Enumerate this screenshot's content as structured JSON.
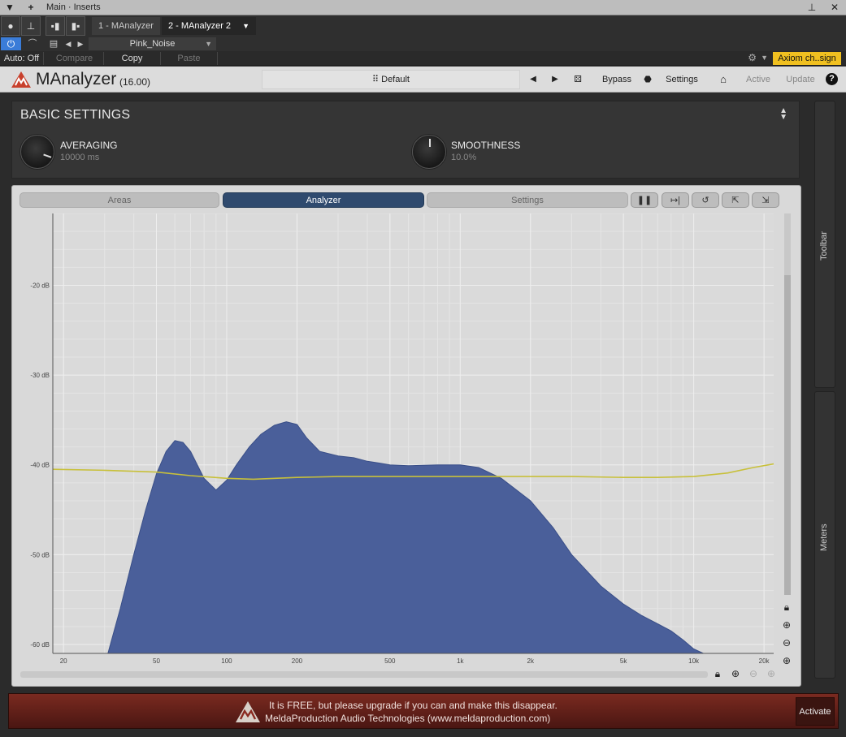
{
  "host": {
    "title": "Main · Inserts",
    "tabs": [
      {
        "label": "1 - MAnalyzer"
      },
      {
        "label": "2 - MAnalyzer 2"
      }
    ],
    "preset_name": "Pink_Noise",
    "auto_label": "Auto: Off",
    "compare_label": "Compare",
    "copy_label": "Copy",
    "paste_label": "Paste",
    "user_badge": "Axiom ch..sign"
  },
  "plugin": {
    "name": "MAnalyzer",
    "version": "(16.00)",
    "preset": "Default",
    "bypass_label": "Bypass",
    "settings_label": "Settings",
    "active_label": "Active",
    "update_label": "Update",
    "help_label": "?"
  },
  "basic_settings": {
    "title": "BASIC SETTINGS",
    "averaging": {
      "label": "AVERAGING",
      "value": "10000 ms",
      "level": 0.9
    },
    "smoothness": {
      "label": "SMOOTHNESS",
      "value": "10.0%",
      "level": 0.1
    }
  },
  "analyzer": {
    "tabs": [
      {
        "label": "Areas"
      },
      {
        "label": "Analyzer"
      },
      {
        "label": "Settings"
      }
    ],
    "active_tab": 1
  },
  "side": {
    "toolbar_label": "Toolbar",
    "meters_label": "Meters"
  },
  "footer": {
    "line1": "It is FREE, but please upgrade if you can and make this disappear.",
    "line2": "MeldaProduction Audio Technologies (www.meldaproduction.com)",
    "activate_label": "Activate"
  },
  "chart_data": {
    "type": "area",
    "x_scale": "log",
    "xlim": [
      18,
      22000
    ],
    "ylim": [
      -61,
      -12
    ],
    "x_ticks": [
      20,
      50,
      100,
      200,
      500,
      1000,
      2000,
      5000,
      10000,
      20000
    ],
    "x_tick_labels": [
      "20",
      "50",
      "100",
      "200",
      "500",
      "1k",
      "2k",
      "5k",
      "10k",
      "20k"
    ],
    "y_ticks": [
      -20,
      -30,
      -40,
      -50,
      -60
    ],
    "y_tick_labels": [
      "-20 dB",
      "-30 dB",
      "-40 dB",
      "-50 dB",
      "-60 dB"
    ],
    "grid": true,
    "colors": {
      "spectrum": "#4a5f9a",
      "average": "#c8c03a"
    },
    "series": [
      {
        "x": [
          31,
          35,
          40,
          45,
          50,
          55,
          60,
          65,
          70,
          80,
          90,
          100,
          110,
          125,
          140,
          160,
          180,
          200,
          220,
          250,
          300,
          350,
          400,
          450,
          500,
          600,
          800,
          1000,
          1200,
          1500,
          2000,
          2500,
          3000,
          4000,
          5000,
          6000,
          7000,
          8000,
          9000,
          10000,
          11000
        ],
        "y": [
          -61,
          -56,
          -50,
          -45,
          -41,
          -38.5,
          -37.3,
          -37.5,
          -38.5,
          -41.5,
          -42.8,
          -41.7,
          -40,
          -38,
          -36.6,
          -35.6,
          -35.2,
          -35.5,
          -37,
          -38.5,
          -39,
          -39.2,
          -39.6,
          -39.8,
          -40,
          -40.1,
          -40,
          -40,
          -40.3,
          -41.5,
          -44,
          -47,
          -50,
          -53.5,
          -55.5,
          -56.8,
          -57.7,
          -58.5,
          -59.5,
          -60.5,
          -61
        ]
      },
      {
        "x": [
          18,
          30,
          50,
          70,
          100,
          130,
          200,
          300,
          500,
          1000,
          2000,
          3000,
          5000,
          7000,
          10000,
          14000,
          18000,
          22000
        ],
        "y": [
          -40.5,
          -40.6,
          -40.8,
          -41.2,
          -41.5,
          -41.6,
          -41.4,
          -41.3,
          -41.3,
          -41.3,
          -41.3,
          -41.3,
          -41.4,
          -41.4,
          -41.3,
          -40.9,
          -40.3,
          -39.9
        ]
      }
    ]
  }
}
